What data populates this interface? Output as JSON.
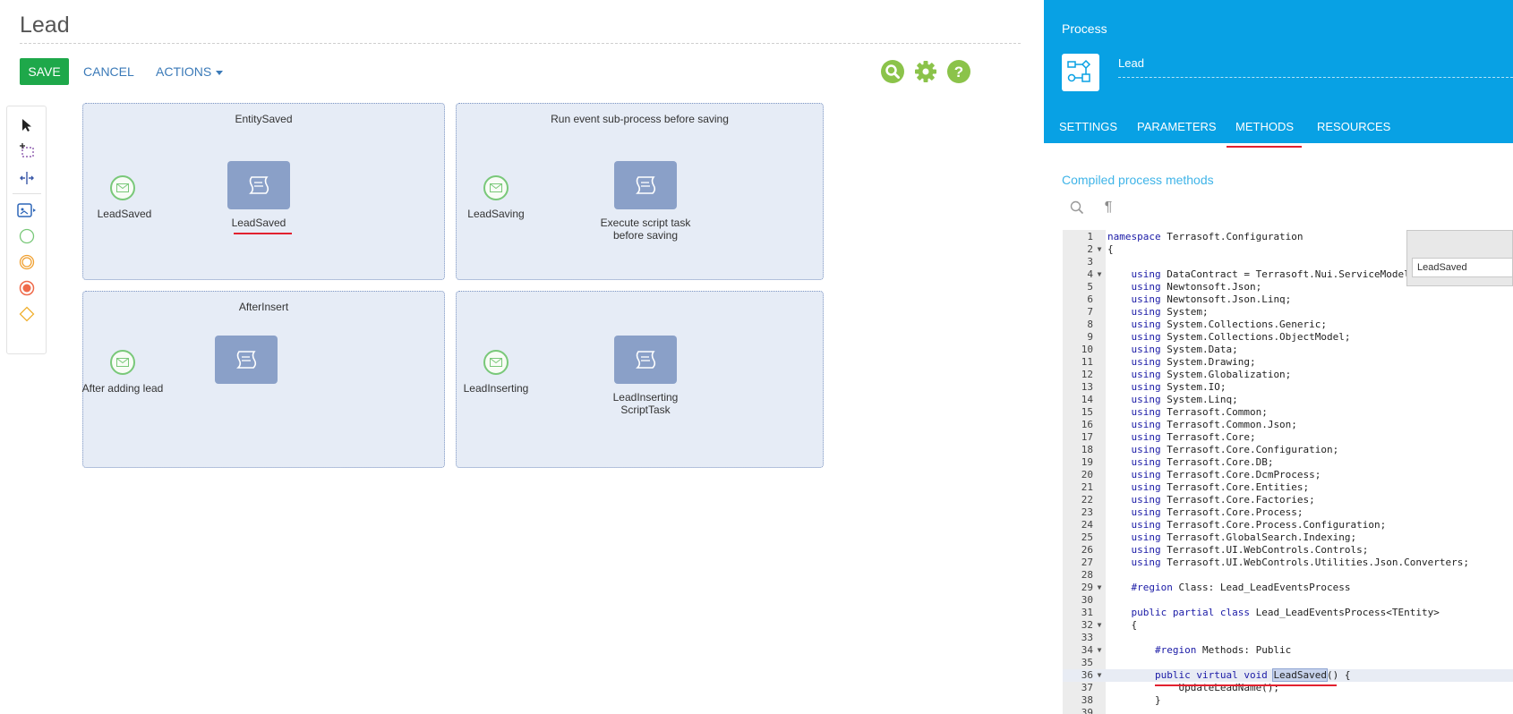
{
  "header": {
    "title": "Lead",
    "save_label": "SAVE",
    "cancel_label": "CANCEL",
    "actions_label": "ACTIONS"
  },
  "colors": {
    "save_button": "#1ea84a",
    "link": "#3b7ab8",
    "panel_bg": "#08a1e4",
    "icon_green": "#8bc34a",
    "highlight_red": "#e2212f"
  },
  "top_icons": [
    "search-icon",
    "gear-icon",
    "help-icon"
  ],
  "palette": {
    "tools": [
      "pointer-icon",
      "lasso-select-icon",
      "space-tool-icon",
      "subprocess-icon",
      "start-event-icon",
      "intermediate-event-icon",
      "end-event-icon",
      "gateway-icon"
    ]
  },
  "diagram": {
    "subprocesses": [
      {
        "title": "EntitySaved",
        "start_label": "LeadSaved",
        "task_label": "LeadSaved"
      },
      {
        "title": "Run event sub-process before saving",
        "start_label": "LeadSaving",
        "task_label_line1": "Execute script task",
        "task_label_line2": "before saving"
      },
      {
        "title": "AfterInsert",
        "start_label": "After adding lead",
        "task_label": ""
      },
      {
        "title": "",
        "start_label": "LeadInserting",
        "task_label_line1": "LeadInserting",
        "task_label_line2": "ScriptTask"
      }
    ]
  },
  "panel": {
    "caption": "Process",
    "process_name": "Lead",
    "tabs": [
      "SETTINGS",
      "PARAMETERS",
      "METHODS",
      "RESOURCES"
    ],
    "active_tab": "METHODS",
    "section_title": "Compiled process methods",
    "search_value": "LeadSaved"
  },
  "code": {
    "lines": [
      {
        "n": "1",
        "fold": "",
        "kw": "namespace",
        "rest": " Terrasoft.Configuration"
      },
      {
        "n": "2",
        "fold": "▼",
        "kw": "",
        "rest": "{"
      },
      {
        "n": "3",
        "fold": "",
        "kw": "",
        "rest": ""
      },
      {
        "n": "4",
        "fold": "▼",
        "kw": "    using",
        "rest": " DataContract = Terrasoft.Nui.ServiceModel"
      },
      {
        "n": "5",
        "fold": "",
        "kw": "    using",
        "rest": " Newtonsoft.Json;"
      },
      {
        "n": "6",
        "fold": "",
        "kw": "    using",
        "rest": " Newtonsoft.Json.Linq;"
      },
      {
        "n": "7",
        "fold": "",
        "kw": "    using",
        "rest": " System;"
      },
      {
        "n": "8",
        "fold": "",
        "kw": "    using",
        "rest": " System.Collections.Generic;"
      },
      {
        "n": "9",
        "fold": "",
        "kw": "    using",
        "rest": " System.Collections.ObjectModel;"
      },
      {
        "n": "10",
        "fold": "",
        "kw": "    using",
        "rest": " System.Data;"
      },
      {
        "n": "11",
        "fold": "",
        "kw": "    using",
        "rest": " System.Drawing;"
      },
      {
        "n": "12",
        "fold": "",
        "kw": "    using",
        "rest": " System.Globalization;"
      },
      {
        "n": "13",
        "fold": "",
        "kw": "    using",
        "rest": " System.IO;"
      },
      {
        "n": "14",
        "fold": "",
        "kw": "    using",
        "rest": " System.Linq;"
      },
      {
        "n": "15",
        "fold": "",
        "kw": "    using",
        "rest": " Terrasoft.Common;"
      },
      {
        "n": "16",
        "fold": "",
        "kw": "    using",
        "rest": " Terrasoft.Common.Json;"
      },
      {
        "n": "17",
        "fold": "",
        "kw": "    using",
        "rest": " Terrasoft.Core;"
      },
      {
        "n": "18",
        "fold": "",
        "kw": "    using",
        "rest": " Terrasoft.Core.Configuration;"
      },
      {
        "n": "19",
        "fold": "",
        "kw": "    using",
        "rest": " Terrasoft.Core.DB;"
      },
      {
        "n": "20",
        "fold": "",
        "kw": "    using",
        "rest": " Terrasoft.Core.DcmProcess;"
      },
      {
        "n": "21",
        "fold": "",
        "kw": "    using",
        "rest": " Terrasoft.Core.Entities;"
      },
      {
        "n": "22",
        "fold": "",
        "kw": "    using",
        "rest": " Terrasoft.Core.Factories;"
      },
      {
        "n": "23",
        "fold": "",
        "kw": "    using",
        "rest": " Terrasoft.Core.Process;"
      },
      {
        "n": "24",
        "fold": "",
        "kw": "    using",
        "rest": " Terrasoft.Core.Process.Configuration;"
      },
      {
        "n": "25",
        "fold": "",
        "kw": "    using",
        "rest": " Terrasoft.GlobalSearch.Indexing;"
      },
      {
        "n": "26",
        "fold": "",
        "kw": "    using",
        "rest": " Terrasoft.UI.WebControls.Controls;"
      },
      {
        "n": "27",
        "fold": "",
        "kw": "    using",
        "rest": " Terrasoft.UI.WebControls.Utilities.Json.Converters;"
      },
      {
        "n": "28",
        "fold": "",
        "kw": "",
        "rest": ""
      },
      {
        "n": "29",
        "fold": "▼",
        "kw": "    #region",
        "rest": " Class: Lead_LeadEventsProcess"
      },
      {
        "n": "30",
        "fold": "",
        "kw": "",
        "rest": ""
      },
      {
        "n": "31",
        "fold": "",
        "kw": "    public partial class",
        "rest": " Lead_LeadEventsProcess<TEntity>"
      },
      {
        "n": "32",
        "fold": "▼",
        "kw": "",
        "rest": "    {"
      },
      {
        "n": "33",
        "fold": "",
        "kw": "",
        "rest": ""
      },
      {
        "n": "34",
        "fold": "▼",
        "kw": "        #region",
        "rest": " Methods: Public"
      },
      {
        "n": "35",
        "fold": "",
        "kw": "",
        "rest": ""
      },
      {
        "n": "36",
        "fold": "▼",
        "kw": "        public virtual void",
        "rest": " LeadSaved() {"
      },
      {
        "n": "37",
        "fold": "",
        "kw": "",
        "rest": "            UpdateLeadName();"
      },
      {
        "n": "38",
        "fold": "",
        "kw": "",
        "rest": "        }"
      },
      {
        "n": "39",
        "fold": "",
        "kw": "",
        "rest": ""
      }
    ]
  }
}
